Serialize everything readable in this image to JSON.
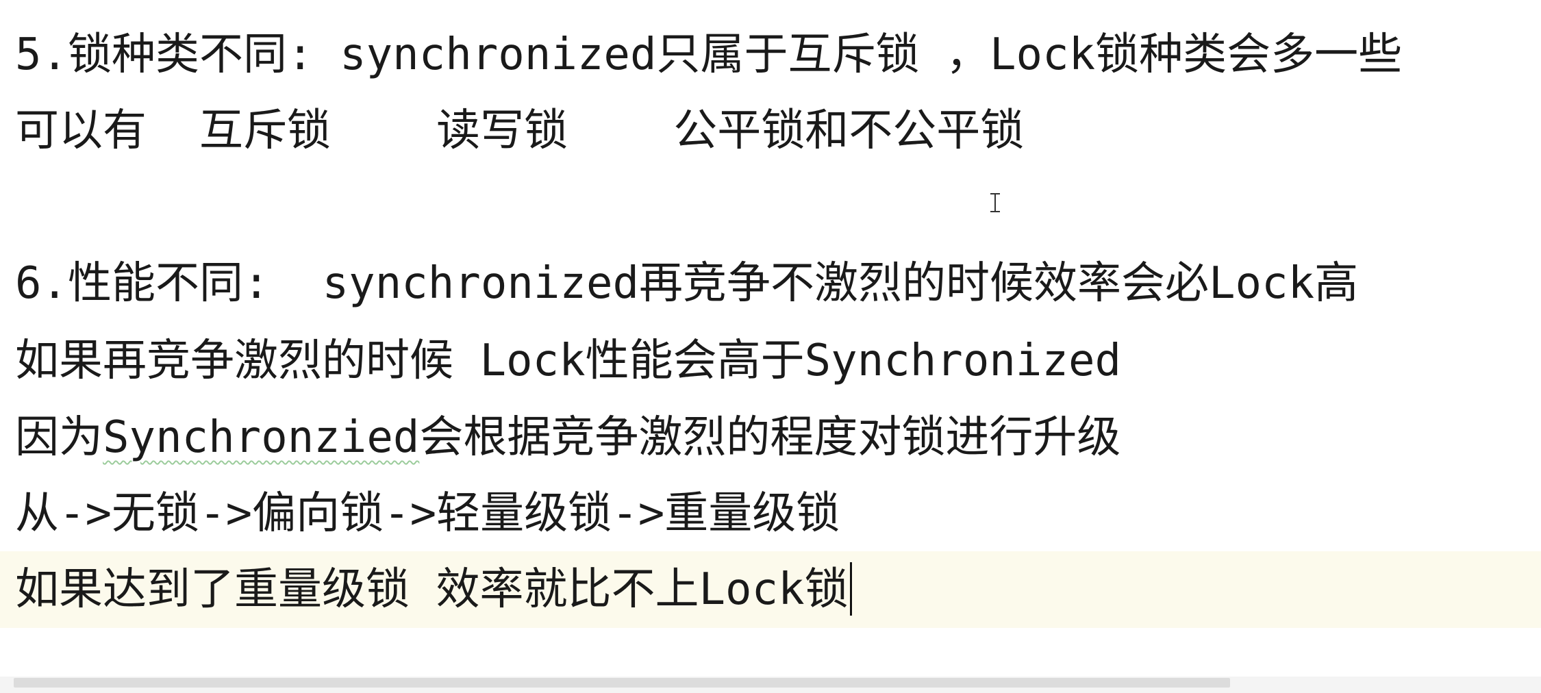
{
  "editor": {
    "lines": [
      "5.锁种类不同: synchronized只属于互斥锁 ，Lock锁种类会多一些",
      "可以有  互斥锁    读写锁    公平锁和不公平锁",
      "",
      "6.性能不同:  synchronized再竞争不激烈的时候效率会必Lock高",
      "如果再竞争激烈的时候 Lock性能会高于Synchronized",
      {
        "prefix": "因为",
        "misspelled": "Synchronzied",
        "suffix": "会根据竞争激烈的程度对锁进行升级"
      },
      "从->无锁->偏向锁->轻量级锁->重量级锁",
      "如果达到了重量级锁 效率就比不上Lock锁"
    ],
    "current_line_index": 7
  }
}
